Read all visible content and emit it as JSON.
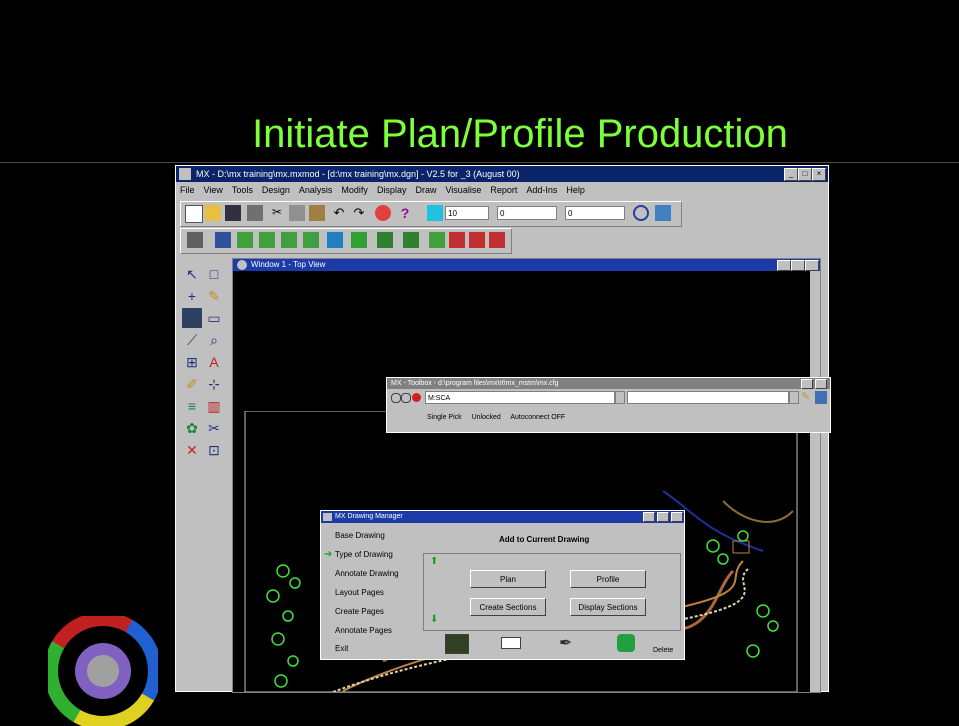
{
  "slide": {
    "title": "Initiate Plan/Profile Production"
  },
  "app": {
    "title": "MX - D:\\mx training\\mx.mxmod - [d:\\mx training\\mx.dgn] - V2.5 for _3 (August 00)",
    "menus": [
      "File",
      "View",
      "Tools",
      "Design",
      "Analysis",
      "Modify",
      "Display",
      "Draw",
      "Visualise",
      "Report",
      "Add-Ins",
      "Help"
    ],
    "toolbar": {
      "level_value": "10",
      "weight_value": "0",
      "style_value": "0"
    }
  },
  "view": {
    "title": "Window 1 - Top View"
  },
  "mx_tools": {
    "title": "MX - Toolbox - d:\\program files\\mx\\rt\\mx_mstm\\mx.cfg",
    "field_value": "M:SCA",
    "status": [
      "Single Pick",
      "Unlocked",
      "Autoconnect OFF"
    ]
  },
  "dialog": {
    "title": "MX Drawing Manager",
    "heading": "Add to Current Drawing",
    "steps": [
      "Base Drawing",
      "Type of Drawing",
      "Annotate Drawing",
      "Layout Pages",
      "Create Pages",
      "Annotate Pages",
      "Exit"
    ],
    "active_step": "Type of Drawing",
    "buttons": {
      "plan": "Plan",
      "profile": "Profile",
      "create_sections": "Create Sections",
      "display_sections": "Display Sections"
    },
    "footer": "Delete"
  },
  "colors": {
    "title_green": "#7dff3c",
    "win_blue": "#0a246a",
    "accent": "#1c3aa8"
  }
}
